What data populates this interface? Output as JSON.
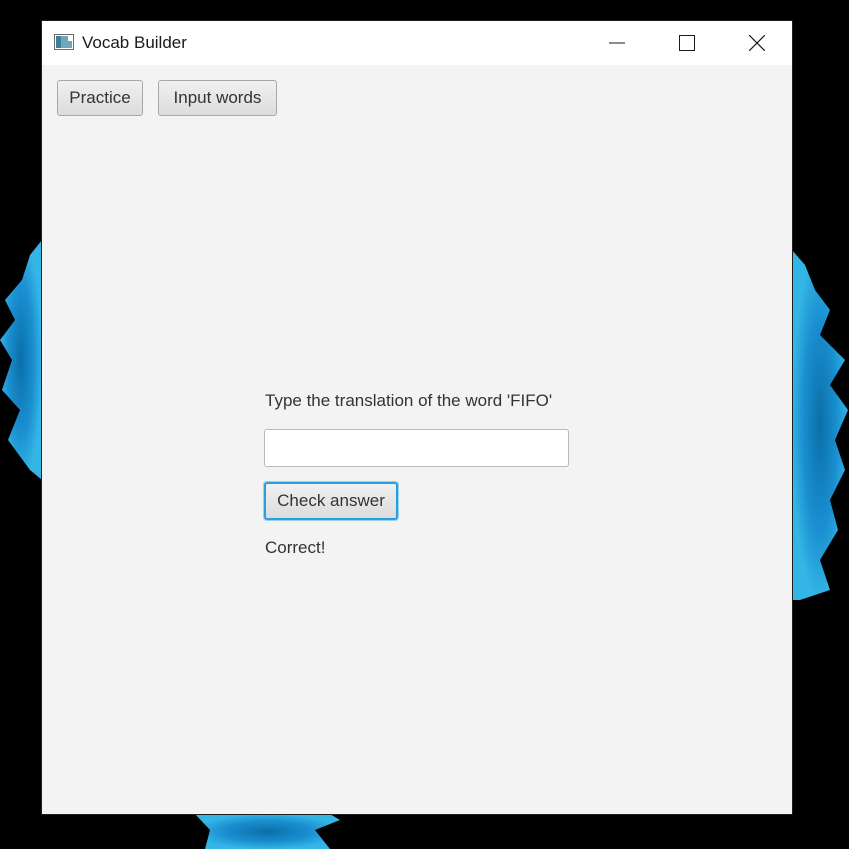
{
  "window": {
    "title": "Vocab Builder",
    "icon": "app-window-icon",
    "controls": {
      "minimize_icon": "minimize-icon",
      "maximize_icon": "maximize-icon",
      "close_icon": "close-icon"
    }
  },
  "toolbar": {
    "practice_label": "Practice",
    "input_words_label": "Input words"
  },
  "practice": {
    "prompt": "Type the translation of the word 'FIFO'",
    "answer_value": "",
    "answer_placeholder": "",
    "check_label": "Check answer",
    "result": "Correct!"
  },
  "colors": {
    "desktop_background": "#000000",
    "wallpaper_accent": "#1a8fd0",
    "window_background": "#f3f3f3",
    "titlebar_background": "#ffffff",
    "focus_ring": "#2b9ee0"
  }
}
